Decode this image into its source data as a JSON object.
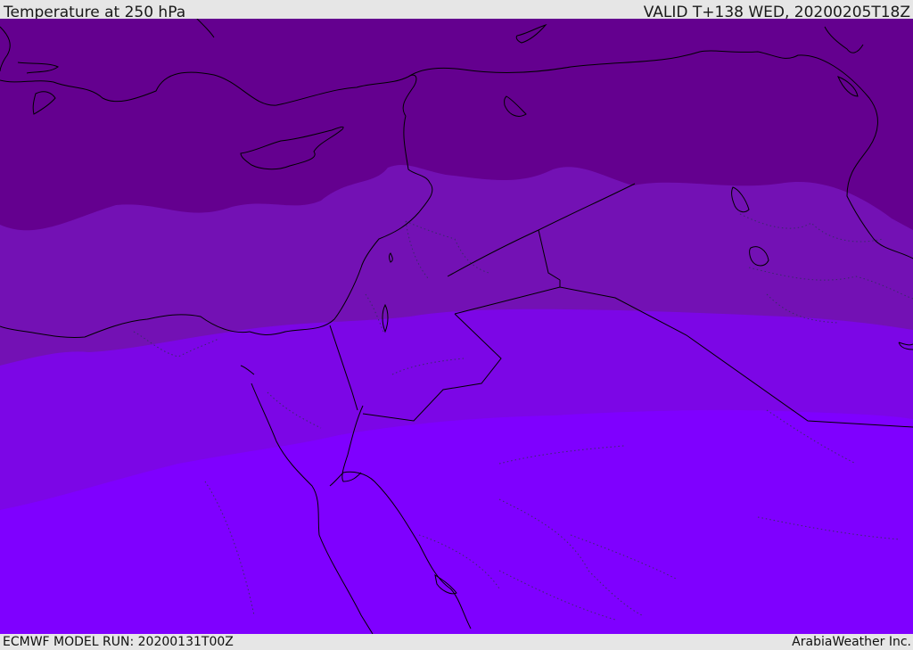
{
  "header": {
    "title": "Temperature at 250 hPa",
    "valid": "VALID T+138 WED, 20200205T18Z"
  },
  "footer": {
    "model_run": "ECMWF MODEL RUN: 20200131T00Z",
    "credit": "ArabiaWeather Inc."
  },
  "map": {
    "field": "temperature",
    "level": "250 hPa",
    "colors": {
      "band_darkest": "#64008f",
      "band_dark": "#7311b4",
      "band_mid": "#7c06e6",
      "band_light": "#7f00ff",
      "coastline": "#000000",
      "border_dotted": "#3a2a6a"
    }
  }
}
